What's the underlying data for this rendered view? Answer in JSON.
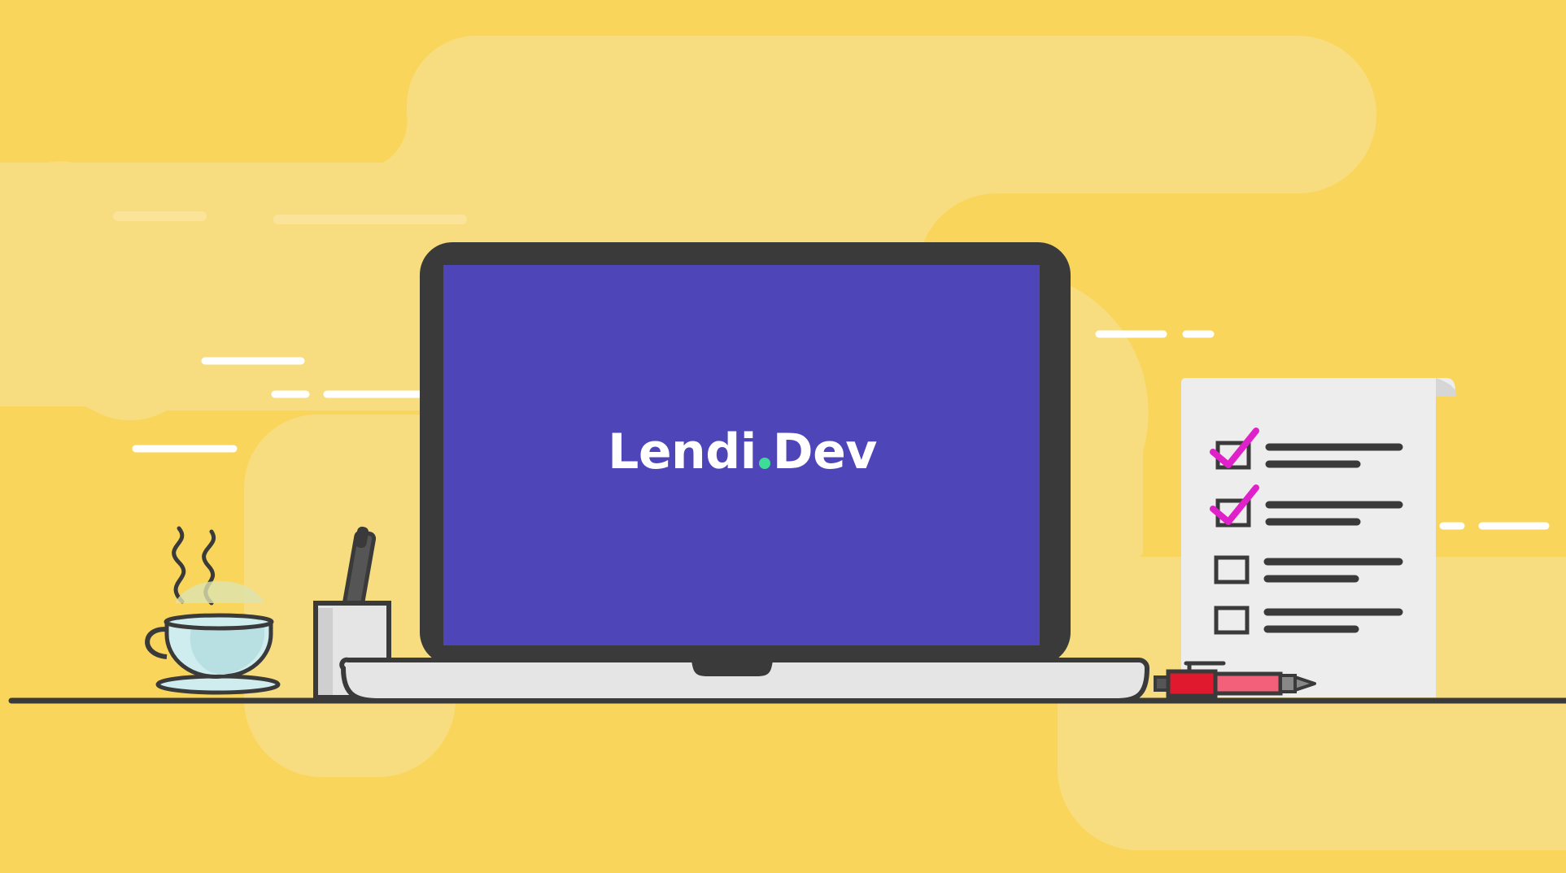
{
  "brand": {
    "name_left": "Lendi",
    "name_right": "Dev",
    "dot_color": "#3DDC97"
  },
  "colors": {
    "background": "#F9D65B",
    "blob": "#F7DD7F",
    "screen": "#4E45B8",
    "bezel": "#3A3A3A",
    "check": "#E020C8",
    "pen_body": "#E0192E",
    "pen_grip": "#F2607A",
    "cup": "#CFEDEE"
  },
  "checklist": {
    "items": [
      {
        "checked": true
      },
      {
        "checked": true
      },
      {
        "checked": false
      },
      {
        "checked": false
      }
    ]
  },
  "icons": [
    "coffee-cup-icon",
    "pen-holder-icon",
    "laptop-icon",
    "checklist-icon",
    "pen-icon"
  ]
}
